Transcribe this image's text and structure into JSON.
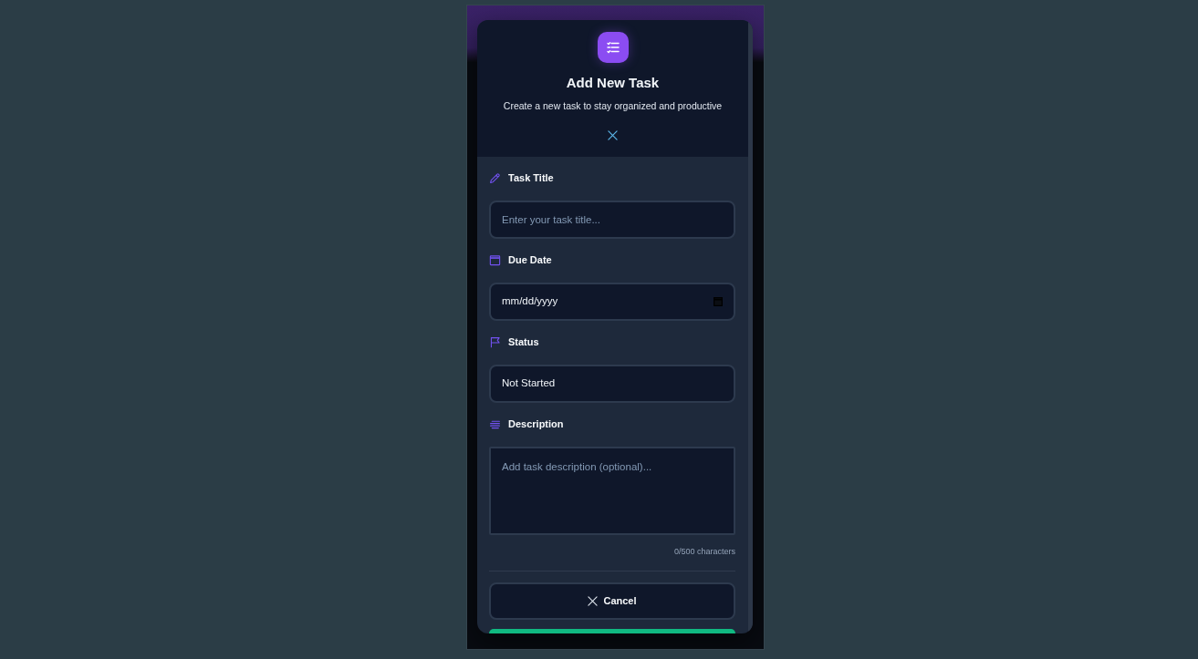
{
  "modal": {
    "title": "Add New Task",
    "subtitle": "Create a new task to stay organized and productive"
  },
  "fields": [
    {
      "kind": "text",
      "label": "Task Title",
      "placeholder": "Enter your task title..."
    },
    {
      "kind": "date",
      "label": "Due Date",
      "value": "mm/dd/yyyy"
    },
    {
      "kind": "select",
      "label": "Status",
      "value": "Not Started"
    },
    {
      "kind": "textarea",
      "label": "Description",
      "placeholder": "Add task description (optional)...",
      "counter": "0/500 characters"
    }
  ],
  "buttons": [
    {
      "kind": "cancel",
      "label": "Cancel"
    },
    {
      "kind": "confirm"
    }
  ]
}
